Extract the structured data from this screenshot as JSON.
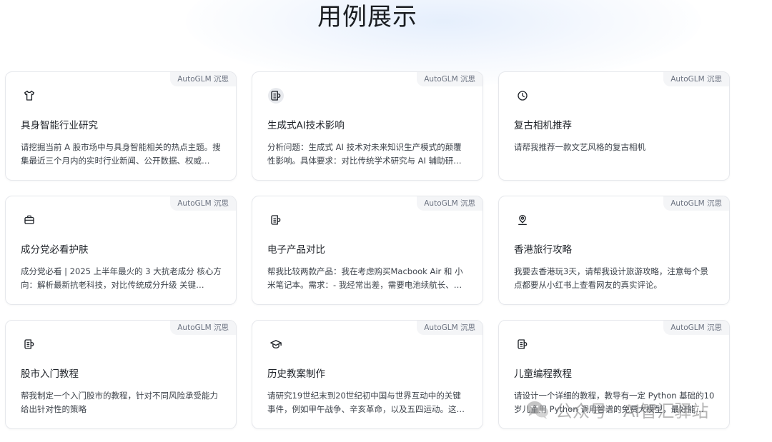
{
  "page": {
    "title": "用例展示"
  },
  "cards": [
    {
      "tag": "AutoGLM 沉思",
      "icon": "tshirt-icon",
      "title": "具身智能行业研究",
      "description": "请挖掘当前 A 股市场中与具身智能相关的热点主题。搜集最近三个月内的实时行业新闻、公开数据、权威…"
    },
    {
      "tag": "AutoGLM 沉思",
      "icon": "document-icon",
      "title": "生成式AI技术影响",
      "description": "分析问题：生成式 AI 技术对未来知识生产模式的颠覆性影响。具体要求：对比传统学术研究与 AI 辅助研…"
    },
    {
      "tag": "AutoGLM 沉思",
      "icon": "clock-icon",
      "title": "复古相机推荐",
      "description": "请帮我推荐一款文艺风格的复古相机"
    },
    {
      "tag": "AutoGLM 沉思",
      "icon": "briefcase-icon",
      "title": "成分党必看护肤",
      "description": "成分党必看 | 2025 上半年最火的 3 大抗老成分 核心方向：解析最新抗老科技，对比传统成分升级 关键…"
    },
    {
      "tag": "AutoGLM 沉思",
      "icon": "document-icon",
      "title": "电子产品对比",
      "description": "帮我比较两款产品：我在考虑购买Macbook Air 和 小米笔记本。需求：- 我经常出差，需要电池续航长、…"
    },
    {
      "tag": "AutoGLM 沉思",
      "icon": "location-pin-icon",
      "title": "香港旅行攻略",
      "description": "我要去香港玩3天，请帮我设计旅游攻略，注意每个景点都要从小红书上查看网友的真实评论。"
    },
    {
      "tag": "AutoGLM 沉思",
      "icon": "document-icon",
      "title": "股市入门教程",
      "description": "帮我制定一个入门股市的教程，针对不同风险承受能力给出针对性的策略"
    },
    {
      "tag": "AutoGLM 沉思",
      "icon": "graduation-cap-icon",
      "title": "历史教案制作",
      "description": "请研究19世纪末到20世纪初中国与世界互动中的关键事件，例如甲午战争、辛亥革命，以及五四运动。这…"
    },
    {
      "tag": "AutoGLM 沉思",
      "icon": "document-icon",
      "title": "儿童编程教程",
      "description": "请设计一个详细的教程，教导有一定 Python 基础的10岁儿童用 Python 调用智谱的免费大模型，最好能…"
    }
  ],
  "watermark": {
    "text": "公众号 · AI智汇驿站",
    "icon": "wechat-icon"
  }
}
